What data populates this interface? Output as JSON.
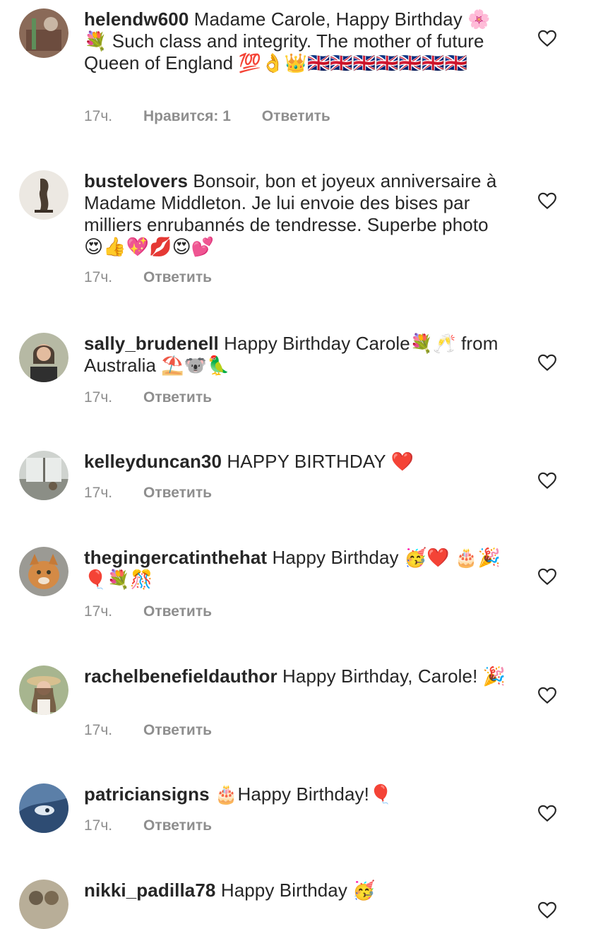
{
  "comments": [
    {
      "username": "helendw600",
      "text": "Madame Carole, Happy Birthday 🌸💐 Such class and integrity. The mother of future Queen of England 💯👌👑🇬🇧🇬🇧🇬🇧🇬🇧🇬🇧🇬🇧🇬🇧",
      "time": "17ч.",
      "likes": "Нравится: 1",
      "reply": "Ответить",
      "avatar_color": "#8a6a58"
    },
    {
      "username": "bustelovers",
      "text": "Bonsoir, bon et joyeux anniversaire à Madame Middleton. Je lui envoie des bises par milliers enrubannés de tendresse. Superbe photo 😍👍💖💋😍💕",
      "time": "17ч.",
      "reply": "Ответить",
      "avatar_color": "#d9d4cc"
    },
    {
      "username": "sally_brudenell",
      "text": "Happy Birthday Carole💐🥂 from Australia ⛱️🐨🦜",
      "time": "17ч.",
      "reply": "Ответить",
      "avatar_color": "#b6b9a4"
    },
    {
      "username": "kelleyduncan30",
      "text": "HAPPY BIRTHDAY ❤️",
      "time": "17ч.",
      "reply": "Ответить",
      "avatar_color": "#9aa09a"
    },
    {
      "username": "thegingercatinthehat",
      "text": "Happy Birthday 🥳❤️ 🎂🎉🎈💐🎊",
      "time": "17ч.",
      "reply": "Ответить",
      "avatar_color": "#c98a4e"
    },
    {
      "username": "rachelbenefieldauthor",
      "text": "Happy Birthday, Carole! 🎉",
      "time": "17ч.",
      "reply": "Ответить",
      "avatar_color": "#a7b58f"
    },
    {
      "username": "patriciansigns",
      "text": "🎂Happy Birthday!🎈",
      "time": "17ч.",
      "reply": "Ответить",
      "avatar_color": "#5b7fa8"
    },
    {
      "username": "nikki_padilla78",
      "text": "Happy Birthday 🥳",
      "avatar_color": "#7a7060"
    }
  ],
  "colors": {
    "text": "#262626",
    "meta": "#8e8e8e",
    "background": "#ffffff"
  },
  "icons": {
    "like": "heart-outline-icon"
  }
}
